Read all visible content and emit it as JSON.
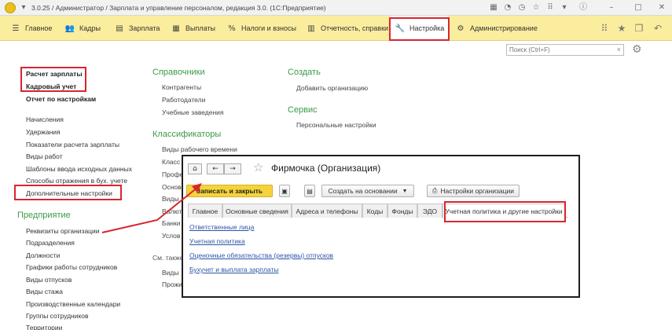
{
  "window": {
    "title": "3.0.25 / Администратор / Зарплата и управление персоналом, редакция 3.0. (1С:Предприятие)",
    "icons": [
      "app-logo",
      "minimize",
      "maximize",
      "close"
    ]
  },
  "menu": {
    "items": [
      {
        "label": "Главное",
        "icon": "hamburger-icon"
      },
      {
        "label": "Кадры",
        "icon": "people-icon"
      },
      {
        "label": "Зарплата",
        "icon": "calculator-icon"
      },
      {
        "label": "Выплаты",
        "icon": "money-icon"
      },
      {
        "label": "Налоги и взносы",
        "icon": "percent-icon"
      },
      {
        "label": "Отчетность, справки",
        "icon": "report-icon"
      },
      {
        "label": "Настройка",
        "icon": "wrench-icon",
        "active": true
      },
      {
        "label": "Администрирование",
        "icon": "gear-icon"
      }
    ]
  },
  "search": {
    "placeholder": "Поиск (Ctrl+F)"
  },
  "left": {
    "links_bold": [
      "Расчет зарплаты",
      "Кадровый учет",
      "Отчет по настройкам"
    ],
    "links": [
      "Начисления",
      "Удержания",
      "Показатели расчета зарплаты",
      "Виды работ",
      "Шаблоны ввода исходных данных",
      "Способы отражения в бух. учете",
      "Дополнительные настройки"
    ],
    "enterprise_header": "Предприятие",
    "enterprise_links": [
      "Реквизиты организации",
      "Подразделения",
      "Должности",
      "Графики работы сотрудников",
      "Виды отпусков",
      "Виды стажа",
      "Производственные календари",
      "Группы сотрудников",
      "Территории"
    ]
  },
  "middle": {
    "references_header": "Справочники",
    "references": [
      "Контрагенты",
      "Работодатели",
      "Учебные заведения"
    ],
    "classifiers_header": "Классификаторы",
    "classifiers": [
      "Виды рабочего времени",
      "Класс",
      "Профе",
      "Основ",
      "Виды",
      "Валют",
      "Банки",
      "Услов"
    ],
    "see_also": "См. также",
    "see_also_items": [
      "Виды",
      "Прожи"
    ]
  },
  "right": {
    "create_header": "Создать",
    "create_links": [
      "Добавить организацию"
    ],
    "service_header": "Сервис",
    "service_links": [
      "Персональные настройки"
    ]
  },
  "dialog": {
    "title": "Фирмочка (Организация)",
    "buttons": {
      "save_close": "Записать и закрыть",
      "create_based": "Создать на основании",
      "org_settings": "Настройки организации"
    },
    "tabs": [
      "Главное",
      "Основные сведения",
      "Адреса и телефоны",
      "Коды",
      "Фонды",
      "ЭДО",
      "Учетная политика и другие настройки"
    ],
    "active_tab": "Учетная политика и другие настройки",
    "links": [
      "Ответственные лица",
      "Учетная политика",
      "Оценочные обязательства (резервы) отпусков",
      "Бухучет и выплата зарплаты"
    ]
  },
  "colors": {
    "menubar": "#fbed9e",
    "highlight_red": "#d9252d",
    "section_green": "#3a9a45",
    "primary_button": "#f5d33b",
    "link_blue": "#2d55a8"
  }
}
